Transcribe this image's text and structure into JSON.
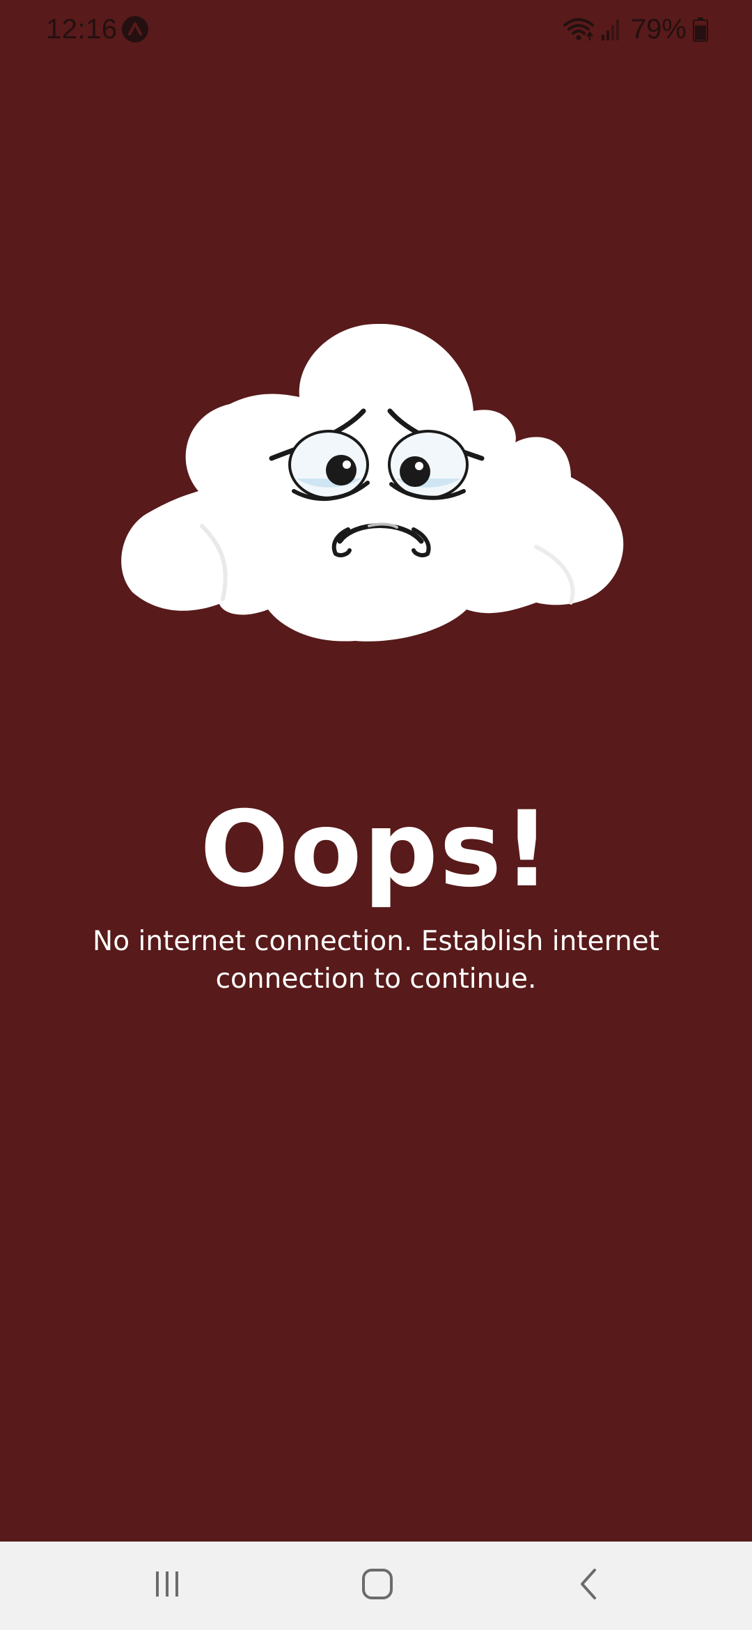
{
  "status_bar": {
    "time": "12:16",
    "app_badge_icon": "app-notification-icon",
    "wifi_icon": "wifi-icon",
    "signal_icon": "cellular-signal-icon",
    "battery_percent": "79%",
    "battery_icon": "battery-icon",
    "battery_level": 0.79
  },
  "illustration": {
    "icon": "sad-cloud-icon"
  },
  "message": {
    "title": "Oops!",
    "body": "No internet connection. Establish internet connection to continue."
  },
  "nav_bar": {
    "recents_icon": "recents-icon",
    "home_icon": "home-icon",
    "back_icon": "back-icon"
  },
  "colors": {
    "background": "#581a1a",
    "text": "#ffffff",
    "nav_background": "#f1f1f1",
    "cloud": "#ffffff"
  }
}
